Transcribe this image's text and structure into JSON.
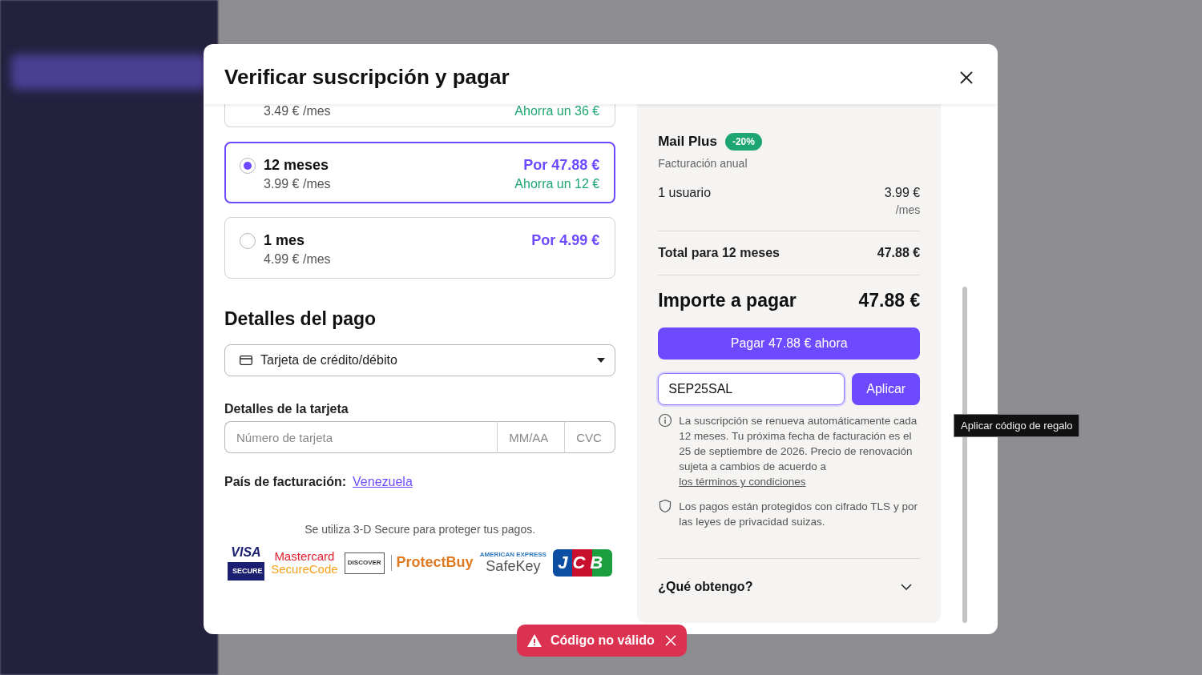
{
  "dialog": {
    "title": "Verificar suscripción y pagar"
  },
  "plans": [
    {
      "price": "3.49 € /mes",
      "saving": "Ahorra un 36 €",
      "selected": false
    },
    {
      "period": "12 meses",
      "price": "3.99 € /mes",
      "total": "Por 47.88 €",
      "saving": "Ahorra un 12 €",
      "selected": true
    },
    {
      "period": "1 mes",
      "price": "4.99 € /mes",
      "total": "Por 4.99 €",
      "selected": false
    }
  ],
  "payment": {
    "heading": "Detalles del pago",
    "method": "Tarjeta de crédito/débito",
    "card_label": "Detalles de la tarjeta",
    "card_number_placeholder": "Número de tarjeta",
    "expiry_placeholder": "MM/AA",
    "cvc_placeholder": "CVC",
    "country_label": "País de facturación:",
    "country": "Venezuela",
    "secure_note": "Se utiliza 3-D Secure para proteger tus pagos."
  },
  "logos": [
    {
      "kind": "visa",
      "lines": [
        "VISA",
        "SECURE"
      ]
    },
    {
      "kind": "mastercard",
      "lines": [
        "Mastercard",
        "SecureCode"
      ]
    },
    {
      "kind": "discover",
      "lines": [
        "DISCOVER",
        "ProtectBuy"
      ]
    },
    {
      "kind": "amex",
      "lines": [
        "AMERICAN EXPRESS",
        "SafeKey"
      ]
    },
    {
      "kind": "jcb",
      "lines": [
        "JCB"
      ]
    }
  ],
  "summary": {
    "product": "Mail Plus",
    "badge": "-20%",
    "billing": "Facturación anual",
    "line_label": "1 usuario",
    "line_price": "3.99 €",
    "line_unit": "/mes",
    "total_label": "Total para 12 meses",
    "total": "47.88 €",
    "due_label": "Importe a pagar",
    "due": "47.88 €",
    "pay_button": "Pagar 47.88 € ahora",
    "coupon_value": "SEP25SAL",
    "apply_button": "Aplicar",
    "tooltip": "Aplicar código de regalo",
    "renew_note": "La suscripción se renueva automáticamente cada 12 meses. Tu próxima fecha de facturación es el 25 de septiembre de 2026. Precio de renovación sujeta a cambios de acuerdo a",
    "terms_link": "los términos y condiciones",
    "security_note": "Los pagos están protegidos con cifrado TLS y por las leyes de privacidad suizas.",
    "faq": {
      "label": "¿Qué obtengo?",
      "expanded": false
    }
  },
  "toast": {
    "message": "Código no válido"
  }
}
